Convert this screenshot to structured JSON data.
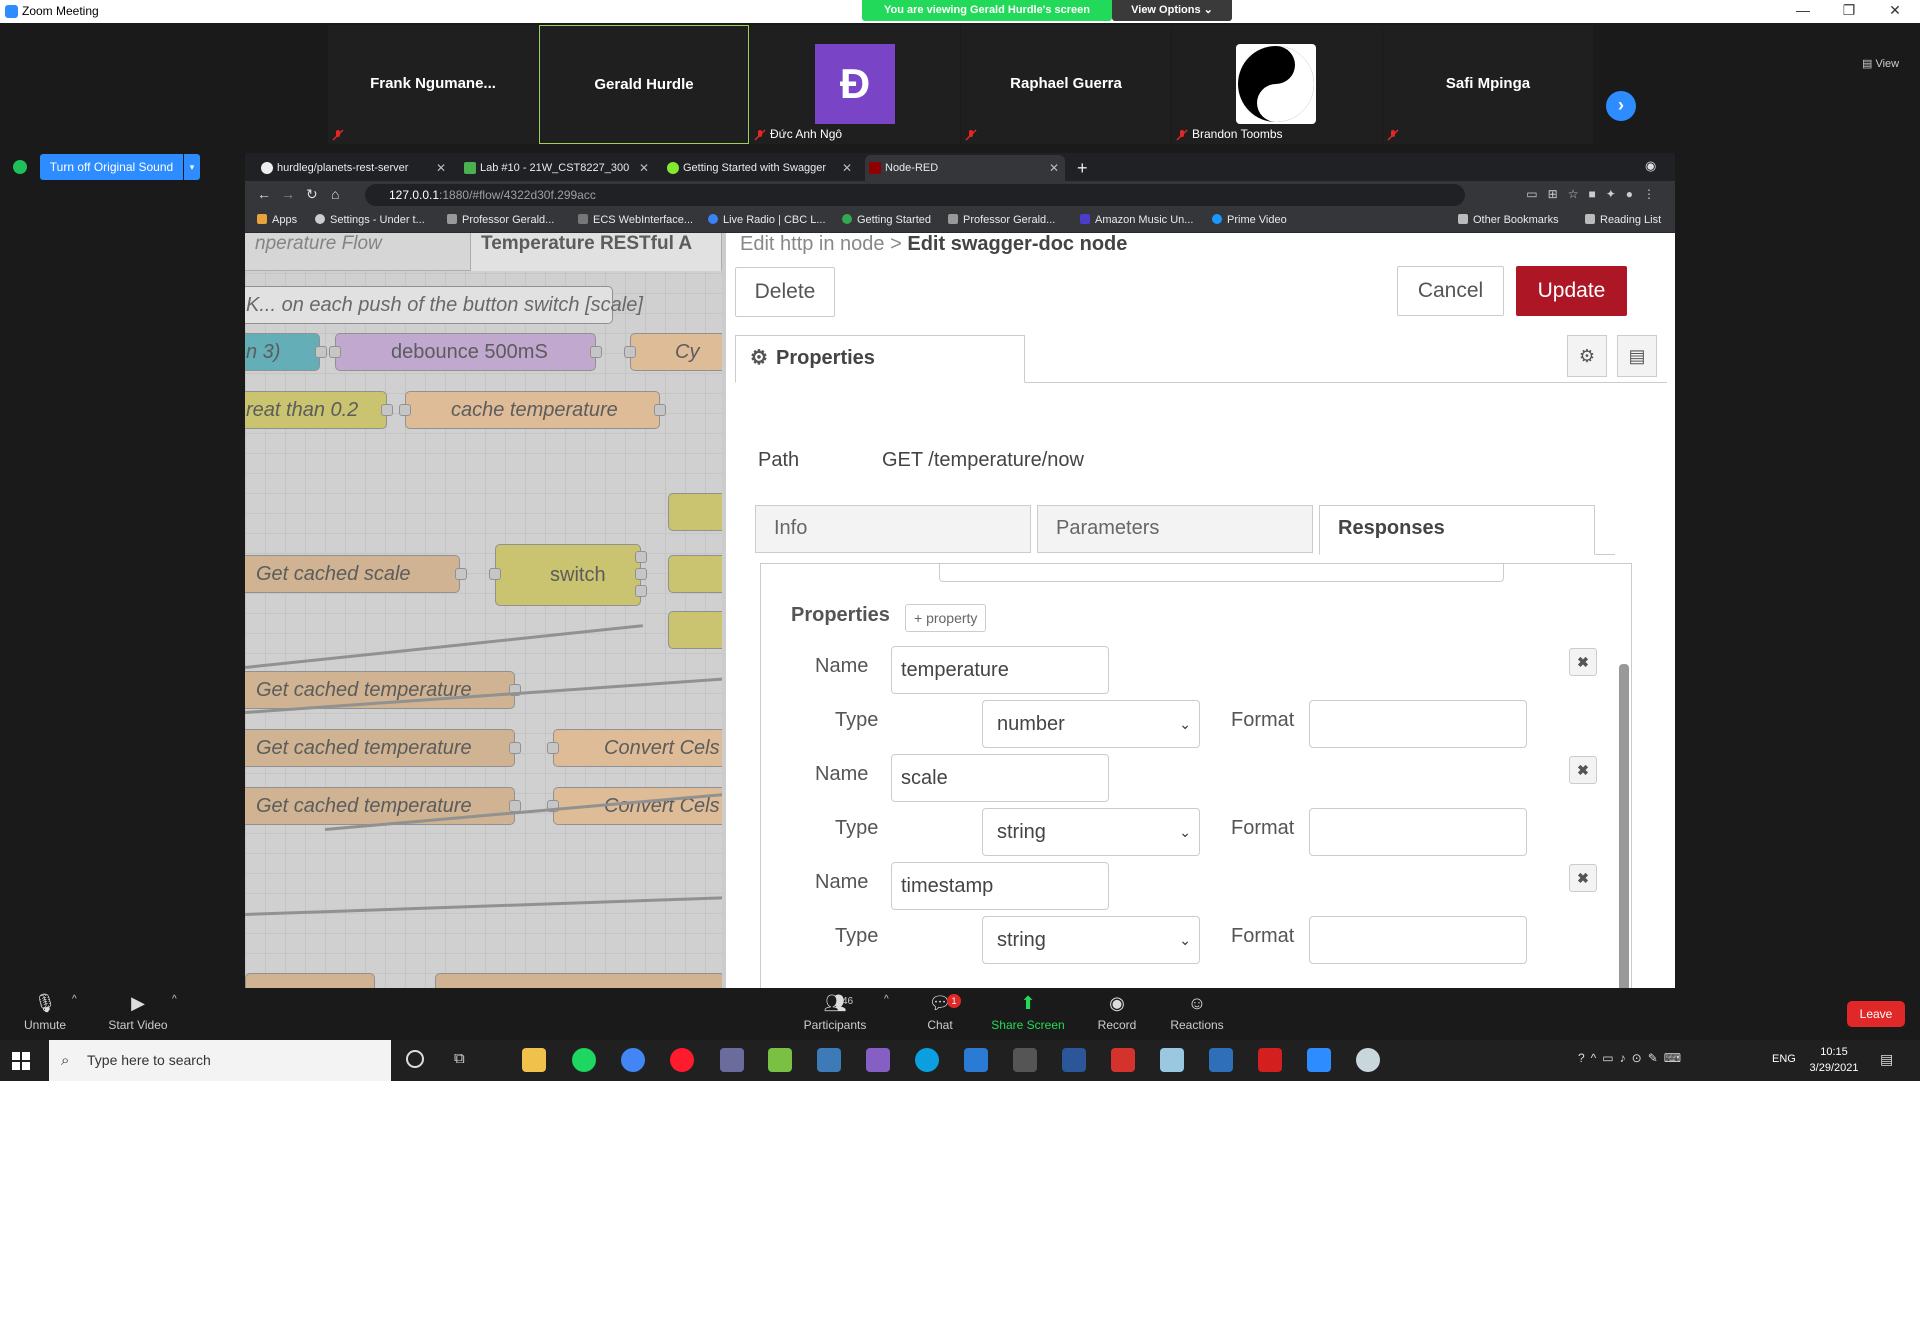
{
  "window": {
    "title": "Zoom Meeting",
    "viewing_banner": "You are viewing Gerald Hurdle's screen",
    "view_options": "View Options ⌄",
    "view_label": "View"
  },
  "participants": [
    {
      "name": "Frank  Ngumane...",
      "label": ""
    },
    {
      "name": "Gerald Hurdle",
      "label": ""
    },
    {
      "name": "",
      "label": "Đức Anh Ngô"
    },
    {
      "name": "Raphael Guerra",
      "label": ""
    },
    {
      "name": "",
      "label": "Brandon Toombs"
    },
    {
      "name": "Safi Mpinga",
      "label": ""
    }
  ],
  "avatar_letter": "Đ",
  "original_sound_button": "Turn off Original Sound",
  "browser": {
    "tabs": [
      {
        "title": "hurdleg/planets-rest-server",
        "active": false
      },
      {
        "title": "Lab #10 - 21W_CST8227_300",
        "active": false
      },
      {
        "title": "Getting Started with Swagger",
        "active": false
      },
      {
        "title": "Node-RED",
        "active": true
      }
    ],
    "url_host": "127.0.0.1",
    "url_path": ":1880/#flow/4322d30f.299acc",
    "bookmarks": [
      "Apps",
      "Settings - Under t...",
      "Professor Gerald...",
      "ECS WebInterface...",
      "Live Radio | CBC L...",
      "Getting Started",
      "Professor Gerald...",
      "Amazon Music Un...",
      "Prime Video"
    ],
    "other_bookmarks": "Other Bookmarks",
    "reading_list": "Reading List"
  },
  "workspace": {
    "tabs": [
      "nperature Flow",
      "Temperature RESTful A"
    ],
    "nodes": {
      "comment": "K... on each push of the button switch [scale]",
      "n3": "n 3)",
      "debounce": "debounce 500mS",
      "cy": "Cy",
      "greater": "reat than 0.2",
      "cache": "cache temperature",
      "get_scale": "Get cached scale",
      "switch": "switch",
      "get_temp1": "Get cached temperature",
      "get_temp2": "Get cached temperature",
      "get_temp3": "Get cached temperature",
      "convert1": "Convert Cels",
      "convert2": "Convert Cels"
    }
  },
  "tray": {
    "breadcrumb_parent": "Edit http in node >",
    "breadcrumb_current": "Edit swagger-doc node",
    "delete": "Delete",
    "cancel": "Cancel",
    "update": "Update",
    "properties_tab": "Properties",
    "path_label": "Path",
    "path_value": "GET /temperature/now",
    "subtabs": [
      "Info",
      "Parameters",
      "Responses"
    ],
    "properties_label": "Properties",
    "add_property": "+ property",
    "fields": [
      {
        "name": "temperature",
        "type": "number",
        "format": ""
      },
      {
        "name": "scale",
        "type": "string",
        "format": ""
      },
      {
        "name": "timestamp",
        "type": "string",
        "format": ""
      }
    ],
    "labels": {
      "name": "Name",
      "type": "Type",
      "format": "Format"
    }
  },
  "zoom_bar": {
    "unmute": "Unmute",
    "start_video": "Start Video",
    "participants": "Participants",
    "participant_count": "46",
    "chat": "Chat",
    "chat_badge": "1",
    "share_screen": "Share Screen",
    "record": "Record",
    "reactions": "Reactions",
    "leave": "Leave"
  },
  "taskbar": {
    "search_placeholder": "Type here to search",
    "lang": "ENG",
    "time": "10:15",
    "date": "3/29/2021"
  }
}
